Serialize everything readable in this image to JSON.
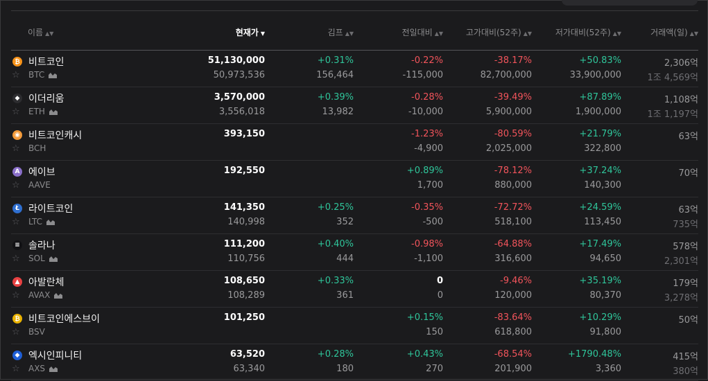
{
  "header": {
    "name": "이름",
    "price": "현재가",
    "kimp": "김프",
    "change": "전일대비",
    "from_high": "고가대비(52주)",
    "from_low": "저가대비(52주)",
    "volume": "거래액(일)"
  },
  "rows": [
    {
      "name": "비트코인",
      "symbol": "BTC",
      "icon_color": "#f7931a",
      "icon_glyph": "₿",
      "has_chart": true,
      "price": "51,130,000",
      "price_sub": "50,973,536",
      "kimp": "+0.31%",
      "kimp_sub": "156,464",
      "change": "-0.22%",
      "change_dir": "down",
      "change_sub": "-115,000",
      "high": "-38.17%",
      "high_sub": "82,700,000",
      "low": "+50.83%",
      "low_sub": "33,900,000",
      "vol": "2,306억",
      "vol_sub": "1조 4,569억"
    },
    {
      "name": "이더리움",
      "symbol": "ETH",
      "icon_color": "#2d2d30",
      "icon_glyph": "◆",
      "has_chart": true,
      "price": "3,570,000",
      "price_sub": "3,556,018",
      "kimp": "+0.39%",
      "kimp_sub": "13,982",
      "change": "-0.28%",
      "change_dir": "down",
      "change_sub": "-10,000",
      "high": "-39.49%",
      "high_sub": "5,900,000",
      "low": "+87.89%",
      "low_sub": "1,900,000",
      "vol": "1,108억",
      "vol_sub": "1조 1,197억"
    },
    {
      "name": "비트코인캐시",
      "symbol": "BCH",
      "icon_color": "#f29a3a",
      "icon_glyph": "◉",
      "has_chart": false,
      "price": "393,150",
      "price_sub": "",
      "kimp": "",
      "kimp_sub": "",
      "change": "-1.23%",
      "change_dir": "down",
      "change_sub": "-4,900",
      "high": "-80.59%",
      "high_sub": "2,025,000",
      "low": "+21.79%",
      "low_sub": "322,800",
      "vol": "63억",
      "vol_sub": ""
    },
    {
      "name": "에이브",
      "symbol": "AAVE",
      "icon_color": "#8a6fc9",
      "icon_glyph": "A",
      "has_chart": false,
      "price": "192,550",
      "price_sub": "",
      "kimp": "",
      "kimp_sub": "",
      "change": "+0.89%",
      "change_dir": "up",
      "change_sub": "1,700",
      "high": "-78.12%",
      "high_sub": "880,000",
      "low": "+37.24%",
      "low_sub": "140,300",
      "vol": "70억",
      "vol_sub": ""
    },
    {
      "name": "라이트코인",
      "symbol": "LTC",
      "icon_color": "#2f6fd0",
      "icon_glyph": "Ł",
      "has_chart": true,
      "price": "141,350",
      "price_sub": "140,998",
      "kimp": "+0.25%",
      "kimp_sub": "352",
      "change": "-0.35%",
      "change_dir": "down",
      "change_sub": "-500",
      "high": "-72.72%",
      "high_sub": "518,100",
      "low": "+24.59%",
      "low_sub": "113,450",
      "vol": "63억",
      "vol_sub": "735억"
    },
    {
      "name": "솔라나",
      "symbol": "SOL",
      "icon_color": "#111114",
      "icon_glyph": "≡",
      "has_chart": true,
      "price": "111,200",
      "price_sub": "110,756",
      "kimp": "+0.40%",
      "kimp_sub": "444",
      "change": "-0.98%",
      "change_dir": "down",
      "change_sub": "-1,100",
      "high": "-64.88%",
      "high_sub": "316,600",
      "low": "+17.49%",
      "low_sub": "94,650",
      "vol": "578억",
      "vol_sub": "2,301억"
    },
    {
      "name": "아발란체",
      "symbol": "AVAX",
      "icon_color": "#e84142",
      "icon_glyph": "▲",
      "has_chart": true,
      "price": "108,650",
      "price_sub": "108,289",
      "kimp": "+0.33%",
      "kimp_sub": "361",
      "change": "0",
      "change_dir": "neutral",
      "change_sub": "0",
      "high": "-9.46%",
      "high_sub": "120,000",
      "low": "+35.19%",
      "low_sub": "80,370",
      "vol": "179억",
      "vol_sub": "3,278억"
    },
    {
      "name": "비트코인에스브이",
      "symbol": "BSV",
      "icon_color": "#eab300",
      "icon_glyph": "₿",
      "has_chart": false,
      "price": "101,250",
      "price_sub": "",
      "kimp": "",
      "kimp_sub": "",
      "change": "+0.15%",
      "change_dir": "up",
      "change_sub": "150",
      "high": "-83.64%",
      "high_sub": "618,800",
      "low": "+10.29%",
      "low_sub": "91,800",
      "vol": "50억",
      "vol_sub": ""
    },
    {
      "name": "엑시인피니티",
      "symbol": "AXS",
      "icon_color": "#1f5fd6",
      "icon_glyph": "◆",
      "has_chart": true,
      "price": "63,520",
      "price_sub": "63,340",
      "kimp": "+0.28%",
      "kimp_sub": "180",
      "change": "+0.43%",
      "change_dir": "up",
      "change_sub": "270",
      "high": "-68.54%",
      "high_sub": "201,900",
      "low": "+1790.48%",
      "low_sub": "3,360",
      "vol": "415억",
      "vol_sub": "380억"
    }
  ]
}
